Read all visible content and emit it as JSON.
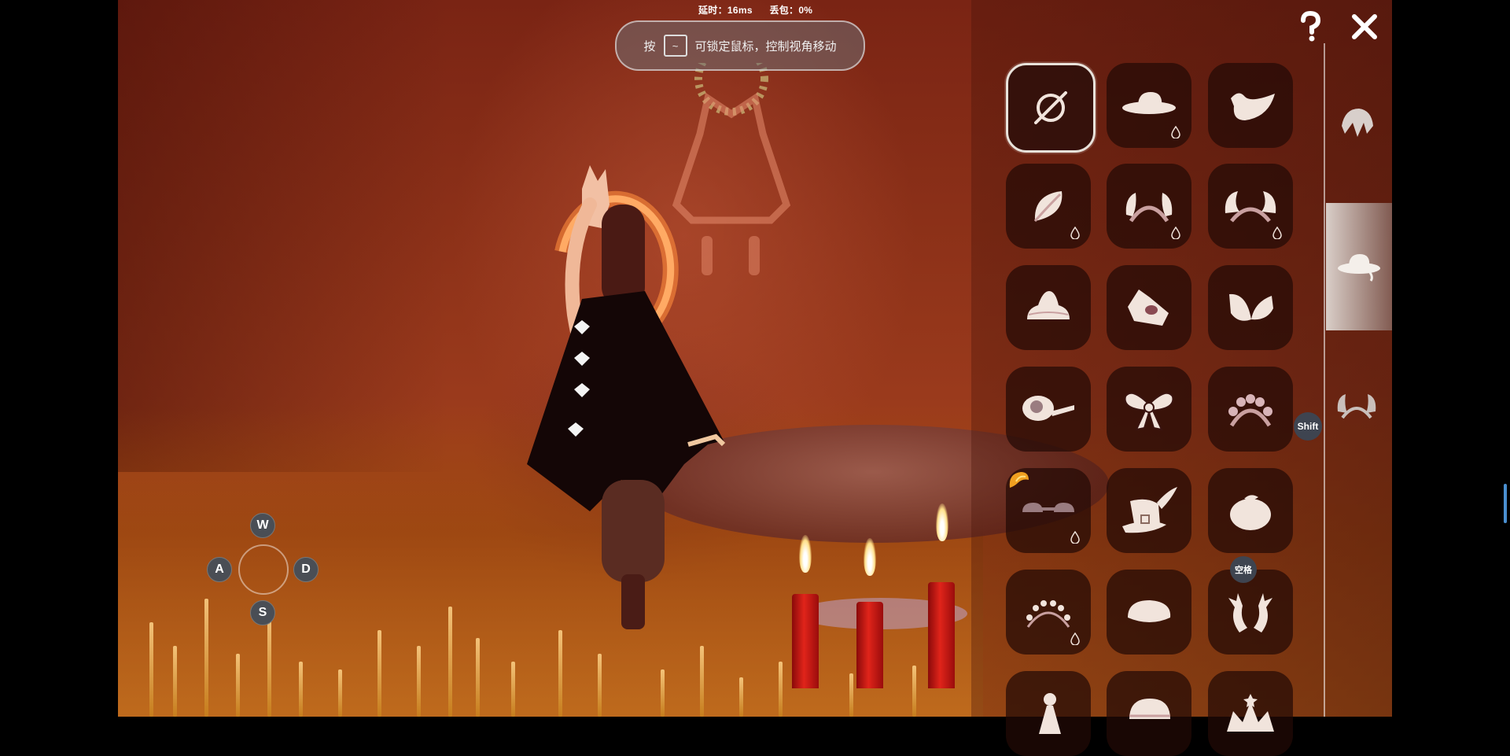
{
  "hud": {
    "latency_label": "延时：16ms",
    "packet_loss_label": "丢包：0%",
    "lock_hint": {
      "prefix": "按",
      "key": "~",
      "suffix": "可锁定鼠标，控制视角移动"
    }
  },
  "controls": {
    "help_icon": "question-mark",
    "close_icon": "x",
    "wasd": {
      "up": "W",
      "left": "A",
      "right": "D",
      "down": "S"
    },
    "shift_badge": "Shift",
    "space_badge": "空格"
  },
  "wardrobe": {
    "items": [
      {
        "name": "none",
        "icon": "empty-set-icon",
        "selected": true
      },
      {
        "name": "sun-hat",
        "icon": "sun-hat-icon",
        "droplet": true
      },
      {
        "name": "bird",
        "icon": "bird-icon"
      },
      {
        "name": "leaf",
        "icon": "leaf-icon",
        "droplet": true
      },
      {
        "name": "ear-headband",
        "icon": "ear-headband-icon",
        "droplet": true
      },
      {
        "name": "wing-headband",
        "icon": "wing-headband-icon",
        "droplet": true
      },
      {
        "name": "swirl-hat",
        "icon": "swirl-hat-icon"
      },
      {
        "name": "onigiri-bow",
        "icon": "onigiri-bow-icon"
      },
      {
        "name": "butterfly-wings",
        "icon": "butterfly-wings-icon"
      },
      {
        "name": "pipe",
        "icon": "pipe-icon"
      },
      {
        "name": "bow",
        "icon": "bow-icon"
      },
      {
        "name": "flower-crown",
        "icon": "flower-crown-icon"
      },
      {
        "name": "goggles",
        "icon": "goggles-icon",
        "droplet": true,
        "new_marker": true
      },
      {
        "name": "witch-hat",
        "icon": "witch-hat-icon"
      },
      {
        "name": "fruit",
        "icon": "fruit-icon"
      },
      {
        "name": "bead-crown",
        "icon": "bead-crown-icon",
        "droplet": true
      },
      {
        "name": "beret",
        "icon": "beret-icon"
      },
      {
        "name": "antlers",
        "icon": "antlers-icon"
      },
      {
        "name": "figure",
        "icon": "figure-icon"
      },
      {
        "name": "cap",
        "icon": "cap-icon"
      },
      {
        "name": "crown",
        "icon": "crown-icon"
      }
    ],
    "categories": [
      {
        "name": "hair",
        "icon": "hair-icon"
      },
      {
        "name": "hat",
        "icon": "hat-icon",
        "active": true
      },
      {
        "name": "horns",
        "icon": "horns-icon"
      }
    ]
  },
  "colors": {
    "sidebar_tile": "#23100a",
    "item_icon": "#f1e4dc",
    "candle": "#e0241a",
    "halo": "#ffb060",
    "scroll_indicator": "#4a8fd0"
  }
}
